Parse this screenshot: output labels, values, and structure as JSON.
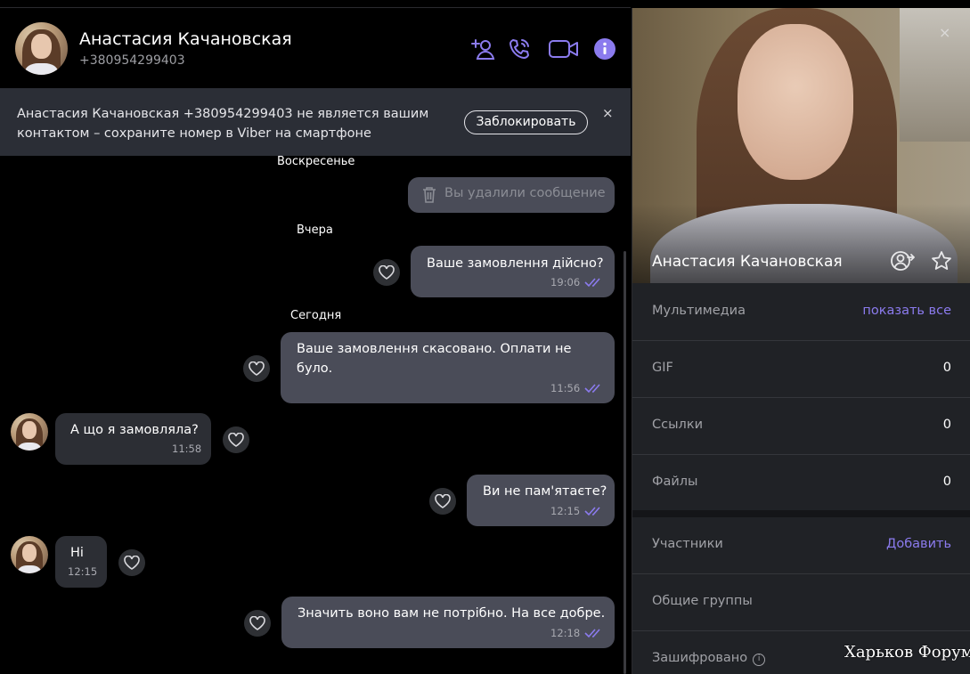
{
  "contact": {
    "name": "Анастасия Качановская",
    "phone": "+380954299403"
  },
  "header_icons": [
    "add-contact-icon",
    "call-icon",
    "video-call-icon",
    "info-icon"
  ],
  "notice": {
    "text": "Анастасия Качановская +380954299403 не является вашим контактом – сохраните номер в Viber на смартфоне",
    "block_label": "Заблокировать",
    "close_label": "×"
  },
  "dates": [
    "Воскресенье",
    "Вчера",
    "Сегодня"
  ],
  "deleted_message": "Вы удалили сообщение",
  "messages": [
    {
      "text": "Ваше замовлення дійсно?",
      "time": "19:06",
      "direction": "out"
    },
    {
      "text_line1": "Ваше замовлення скасовано. Оплати не",
      "text_line2": "було.",
      "time": "11:56",
      "direction": "out"
    },
    {
      "text": "А що я замовляла?",
      "time": "11:58",
      "direction": "in"
    },
    {
      "text": "Ви не пам'ятаєте?",
      "time": "12:15",
      "direction": "out"
    },
    {
      "text": "Ні",
      "time": "12:15",
      "direction": "in"
    },
    {
      "text": "Значить воно вам не потрібно. На все добре.",
      "time": "12:18",
      "direction": "out"
    }
  ],
  "info": {
    "name": "Анастасия Качановская",
    "close_label": "×",
    "media": {
      "label": "Мультимедиа",
      "action": "показать все"
    },
    "gif": {
      "label": "GIF",
      "count": "0"
    },
    "links": {
      "label": "Ссылки",
      "count": "0"
    },
    "files": {
      "label": "Файлы",
      "count": "0"
    },
    "participants": {
      "label": "Участники",
      "action": "Добавить"
    },
    "common_groups": {
      "label": "Общие группы"
    },
    "encrypted": {
      "label": "Зашифровано",
      "icon": "i"
    }
  },
  "watermark": "Харьков Форум",
  "colors": {
    "accent": "#8b7bee",
    "bubble_out": "#4a4c58",
    "bubble_in": "#2c2e34",
    "notice_bg": "#2b2e36",
    "panel_bg": "#202226"
  }
}
